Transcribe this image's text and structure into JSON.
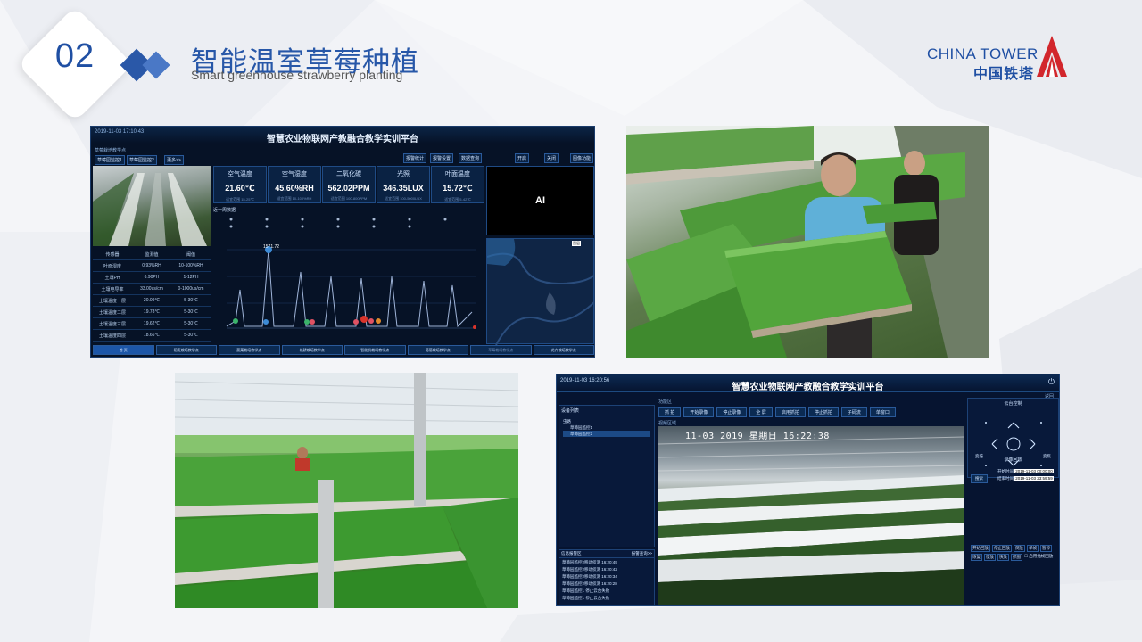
{
  "header": {
    "badge_number": "02",
    "title": "智能温室草莓种植",
    "subtitle": "Smart greenhouse strawberry planting",
    "logo_en": "CHINA TOWER",
    "logo_cn": "中国铁塔",
    "accent_color": "#1f4fa3",
    "logo_red": "#d2262c"
  },
  "dashboard1": {
    "datetime": "2019-11-03 17:10:43",
    "title": "智慧农业物联网产教融合教学实训平台",
    "section_label": "草莓栽培教学点",
    "tabs": [
      "草莓园监控1",
      "草莓园监控2",
      "更多>>"
    ],
    "top_buttons": [
      "报警统计",
      "报警设置",
      "数据查询"
    ],
    "control_buttons": [
      "开启",
      "关闭",
      "图像功能"
    ],
    "metrics": [
      {
        "label": "空气温度",
        "value": "21.60℃",
        "sub": "适宜范围 15-25℃"
      },
      {
        "label": "空气湿度",
        "value": "45.60%RH",
        "sub": "适宜范围 10-100%RH"
      },
      {
        "label": "二氧化碳",
        "value": "562.02PPM",
        "sub": "适宜范围 100-800PPM"
      },
      {
        "label": "光照",
        "value": "346.35LUX",
        "sub": "适宜范围 100-5000LUX"
      },
      {
        "label": "叶面温度",
        "value": "15.72℃",
        "sub": "适宜范围 5-42℃"
      }
    ],
    "ai_label": "AI",
    "chart_label": "近一周数据",
    "table_headers": [
      "传感器",
      "监测值",
      "阈值"
    ],
    "table_rows": [
      [
        "叶面湿度",
        "0.93%RH",
        "10-100%RH"
      ],
      [
        "土壤PH",
        "6.90PH",
        "1-12PH"
      ],
      [
        "土壤电导率",
        "33.00us/cm",
        "0-1000us/cm"
      ],
      [
        "土壤温度一层",
        "20.09℃",
        "5-30℃"
      ],
      [
        "土壤温度二层",
        "19.78℃",
        "5-30℃"
      ],
      [
        "土壤温度三层",
        "19.62℃",
        "5-30℃"
      ],
      [
        "土壤温度四层",
        "18.66℃",
        "5-30℃"
      ]
    ],
    "nav": [
      "首 页",
      "稻麦栽培教学点",
      "蔬菜栽培教学点",
      "机耕栽培教学点",
      "智能机栽培教学点",
      "葡萄栽培教学点",
      "草莓栽培教学点",
      "花卉栽培教学点"
    ],
    "chart_peak_label": "1571.72",
    "map_label": "图层"
  },
  "dashboard2": {
    "datetime": "2019-11-03 16:20:56",
    "title": "智慧农业物联网产教融合教学实训平台",
    "back": "返回",
    "device_list_title": "设备列表",
    "device_tree": [
      "虫路",
      "草莓园监控1",
      "草莓园监控2"
    ],
    "function_area": "功能区",
    "function_buttons": [
      "抓 拍",
      "开始录像",
      "停止录像",
      "全 屏",
      "启用抓拍",
      "停止抓拍",
      "子码流",
      "单窗口"
    ],
    "video_area": "视频区域",
    "osd_text": "11-03 2019 星期日 16:22:38",
    "ptz_title": "云台控制",
    "ptz_labels": [
      "变倍",
      "变焦"
    ],
    "playback_title": "录像回放",
    "search_button": "搜索",
    "start_time_label": "开始时间",
    "start_time": "2019-11-03 00:00:00",
    "end_time_label": "结束时间",
    "end_time": "2019-11-03 23:59:59",
    "playback_buttons": [
      "开始回放",
      "停止回放",
      "倒放",
      "单帧",
      "暂停",
      "恢复",
      "慢放",
      "快放",
      "抓图"
    ],
    "playback_checkbox": "启用抽帧回放",
    "alarm_title": "信息报警区",
    "alarm_more": "报警查询>>",
    "alarms": [
      "草莓园监控2移动侦测 16:20:49",
      "草莓园监控2移动侦测 16:20:42",
      "草莓园监控2移动侦测 16:20:34",
      "草莓园监控2移动侦测 16:20:28",
      "草莓园监控1 停止云台失败",
      "草莓园监控1 停止云台失败"
    ]
  }
}
